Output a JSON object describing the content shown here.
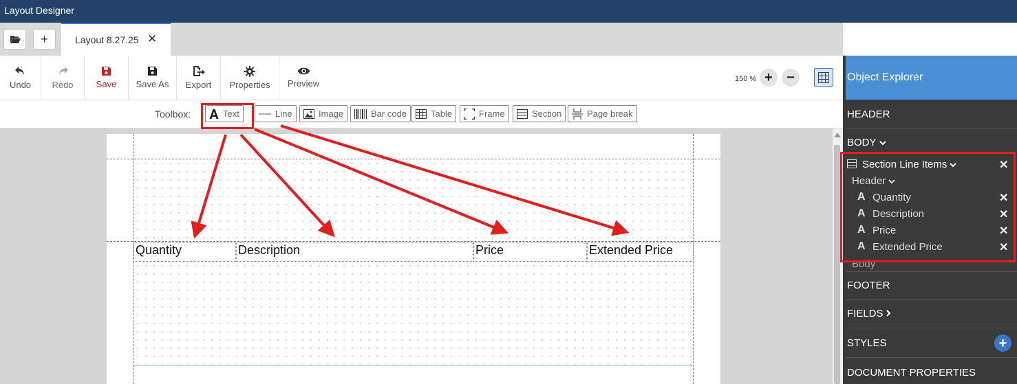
{
  "app": {
    "title": "Layout Designer"
  },
  "tabs": [
    {
      "label": "Layout 8.27.25",
      "close": "✕"
    }
  ],
  "tabbar": {
    "open_icon": "folder-open-icon",
    "new_icon": "plus-icon",
    "new_label": "+"
  },
  "ribbon": {
    "undo": "Undo",
    "redo": "Redo",
    "save": "Save",
    "save_as": "Save As",
    "export": "Export",
    "properties": "Properties",
    "preview": "Preview"
  },
  "zoom": {
    "level": "150 %",
    "in": "+",
    "out": "−"
  },
  "toolbox": {
    "label": "Toolbox:",
    "tools": [
      "Text",
      "Line",
      "Image",
      "Bar code",
      "Table",
      "Frame",
      "Section",
      "Page break"
    ]
  },
  "canvas": {
    "cells": [
      "Quantity",
      "Description",
      "Price",
      "Extended Price"
    ]
  },
  "explorer": {
    "title": "Object Explorer",
    "header": "HEADER",
    "body": "BODY",
    "section": "Section Line Items",
    "section_header": "Header",
    "items": [
      "Quantity",
      "Description",
      "Price",
      "Extended Price"
    ],
    "section_body": "Body",
    "footer": "FOOTER",
    "fields": "FIELDS",
    "styles": "STYLES",
    "document_properties": "DOCUMENT PROPERTIES",
    "remove": "✕",
    "text_glyph": "A",
    "add": "+"
  },
  "colors": {
    "titlebar": "#24426a",
    "accent": "#3a76c2",
    "save": "#cc1f1f",
    "annotation": "#e11f1f",
    "sidebar": "#3a3a3a",
    "sidebar_header": "#4a8ed6"
  }
}
